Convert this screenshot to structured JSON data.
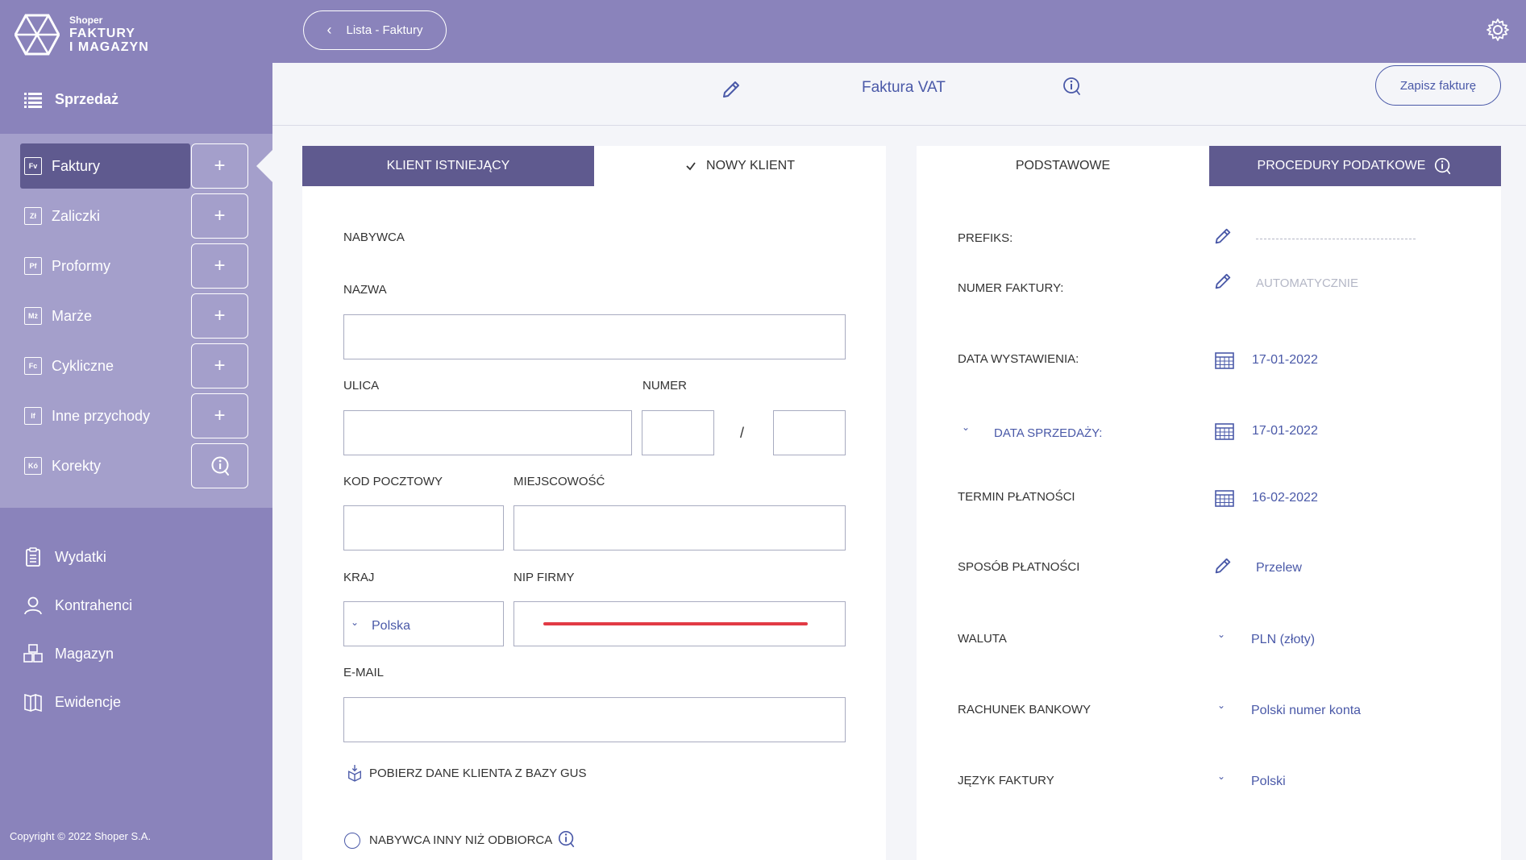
{
  "brand": {
    "small": "Shoper",
    "line1": "FAKTURY",
    "line2": "I MAGAZYN"
  },
  "sidebar": {
    "section_label": "Sprzedaż",
    "items": [
      {
        "label": "Faktury",
        "icon": "Fv",
        "action": "+"
      },
      {
        "label": "Zaliczki",
        "icon": "Zł",
        "action": "+"
      },
      {
        "label": "Proformy",
        "icon": "Pf",
        "action": "+"
      },
      {
        "label": "Marże",
        "icon": "Mż",
        "action": "+"
      },
      {
        "label": "Cykliczne",
        "icon": "Fc",
        "action": "+"
      },
      {
        "label": "Inne przychody",
        "icon": "If",
        "action": "+"
      },
      {
        "label": "Korekty",
        "icon": "Kó",
        "action": "info"
      }
    ],
    "bottom_items": [
      {
        "label": "Wydatki"
      },
      {
        "label": "Kontrahenci"
      },
      {
        "label": "Magazyn"
      },
      {
        "label": "Ewidencje"
      }
    ],
    "copyright": "Copyright © 2022 Shoper S.A."
  },
  "topbar": {
    "back_label": "Lista - Faktury"
  },
  "header": {
    "title": "Faktura VAT",
    "save_label": "Zapisz fakturę"
  },
  "client_panel": {
    "tabs": {
      "existing": "KLIENT ISTNIEJĄCY",
      "new": "NOWY KLIENT"
    },
    "section": "NABYWCA",
    "fields": {
      "name": "NAZWA",
      "street": "ULICA",
      "number": "NUMER",
      "separator": "/",
      "postal": "KOD POCZTOWY",
      "city": "MIEJSCOWOŚĆ",
      "country": "KRAJ",
      "country_value": "Polska",
      "nip": "NIP FIRMY",
      "email": "E-MAIL"
    },
    "gus_label": "POBIERZ DANE KLIENTA Z BAZY GUS",
    "buyer_other": "NABYWCA INNY NIŻ ODBIORCA"
  },
  "settings_panel": {
    "tabs": {
      "basic": "PODSTAWOWE",
      "tax": "PROCEDURY PODATKOWE"
    },
    "rows": {
      "prefix_label": "PREFIKS:",
      "number_label": "NUMER FAKTURY:",
      "number_value": "AUTOMATYCZNIE",
      "issue_label": "DATA WYSTAWIENIA:",
      "issue_value": "17-01-2022",
      "sale_label": "DATA SPRZEDAŻY:",
      "sale_value": "17-01-2022",
      "due_label": "TERMIN PŁATNOŚCI",
      "due_value": "16-02-2022",
      "payment_label": "SPOSÓB PŁATNOŚCI",
      "payment_value": "Przelew",
      "currency_label": "WALUTA",
      "currency_value": "PLN (złoty)",
      "bank_label": "RACHUNEK BANKOWY",
      "bank_value": "Polski numer konta",
      "lang_label": "JĘZYK FAKTURY",
      "lang_value": "Polski"
    }
  },
  "colors": {
    "sidebar": "#8a83bb",
    "sidebar_mid": "#a49fcb",
    "active": "#5f5a8f",
    "accent_blue": "#4a59a8",
    "nip_error": "#e23b45"
  }
}
